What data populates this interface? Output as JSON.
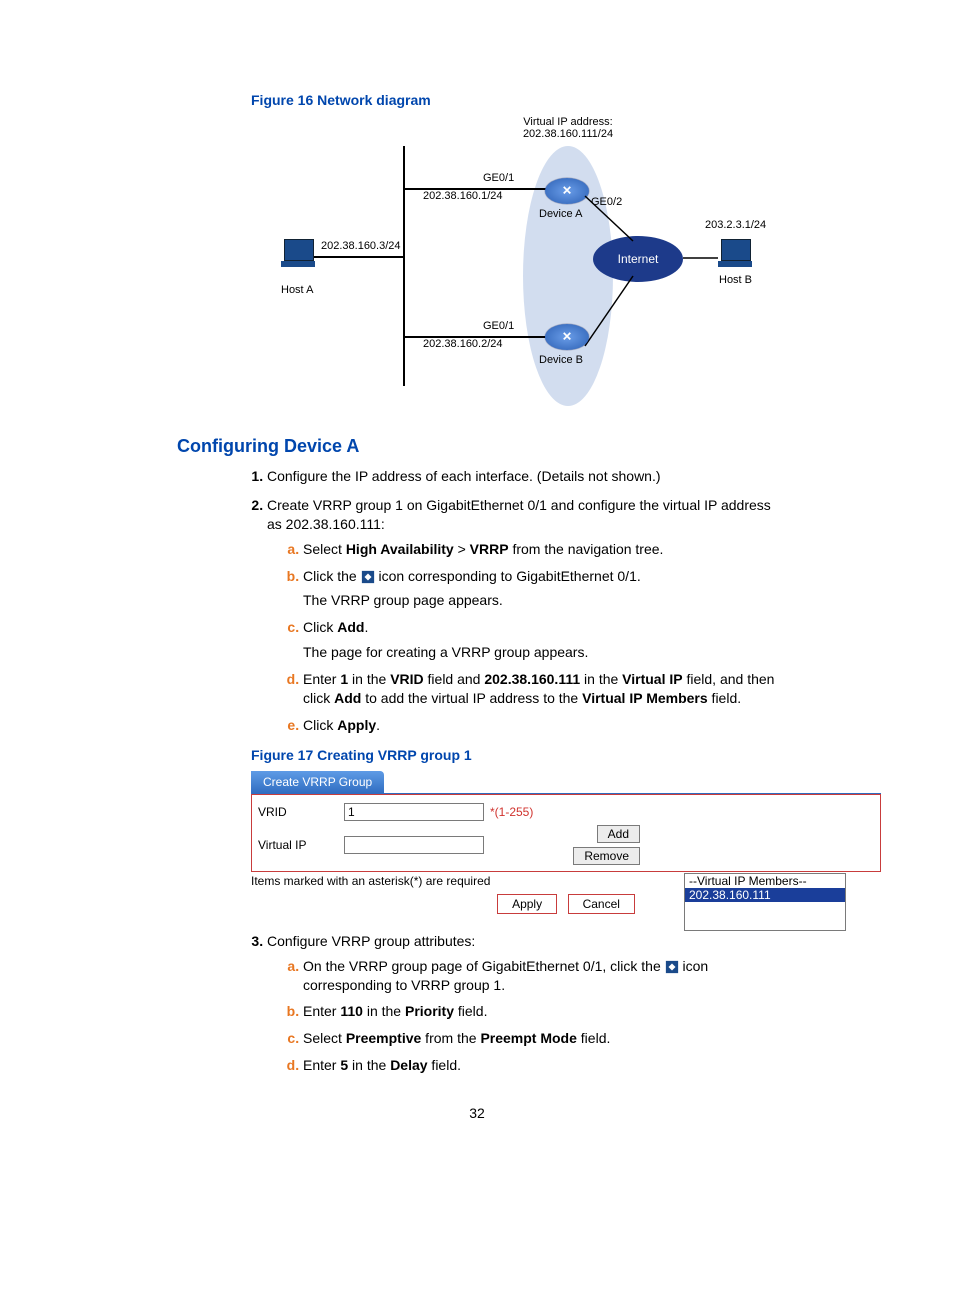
{
  "figure16_caption": "Figure 16 Network diagram",
  "diagram": {
    "virtual_ip_label": "Virtual IP address:",
    "virtual_ip_value": "202.38.160.111/24",
    "ge01_a": "GE0/1",
    "ip_ge01_a": "202.38.160.1/24",
    "ge02": "GE0/2",
    "device_a": "Device A",
    "hostb_ip": "203.2.3.1/24",
    "hosta_ip": "202.38.160.3/24",
    "internet": "Internet",
    "host_a": "Host A",
    "host_b": "Host B",
    "ge01_b": "GE0/1",
    "ip_ge01_b": "202.38.160.2/24",
    "device_b": "Device B"
  },
  "section_title": "Configuring Device A",
  "step1": "Configure the IP address of each interface. (Details not shown.)",
  "step2_pre": "Create VRRP group 1 on GigabitEthernet 0/1 and configure the virtual IP address as 202.38.160.111:",
  "step2a_pre": "Select ",
  "step2a_b1": "High Availability",
  "step2a_mid": " > ",
  "step2a_b2": "VRRP",
  "step2a_post": " from the navigation tree.",
  "step2b_pre": "Click the ",
  "step2b_post": " icon corresponding to GigabitEthernet 0/1.",
  "step2b_follow": "The VRRP group page appears.",
  "step2c_pre": "Click ",
  "step2c_b": "Add",
  "step2c_post": ".",
  "step2c_follow": "The page for creating a VRRP group appears.",
  "step2d_pre": "Enter ",
  "step2d_b1": "1",
  "step2d_mid1": " in the ",
  "step2d_b2": "VRID",
  "step2d_mid2": " field and ",
  "step2d_b3": "202.38.160.111",
  "step2d_mid3": " in the ",
  "step2d_b4": "Virtual IP",
  "step2d_mid4": " field, and then click ",
  "step2d_b5": "Add",
  "step2d_mid5": " to add the virtual IP address to the ",
  "step2d_b6": "Virtual IP Members",
  "step2d_post": " field.",
  "step2e_pre": "Click ",
  "step2e_b": "Apply",
  "step2e_post": ".",
  "figure17_caption": "Figure 17 Creating VRRP group 1",
  "fig17": {
    "tab": "Create VRRP Group",
    "vrid_label": "VRID",
    "vrid_value": "1",
    "vrid_hint": "*(1-255)",
    "vip_label": "Virtual IP",
    "add_btn": "Add",
    "remove_btn": "Remove",
    "members_header": "--Virtual IP Members--",
    "members_item": "202.38.160.111",
    "req_note": "Items marked with an asterisk(*) are required",
    "apply": "Apply",
    "cancel": "Cancel"
  },
  "step3": "Configure VRRP group attributes:",
  "step3a_pre": "On the VRRP group page of GigabitEthernet 0/1, click the ",
  "step3a_post": " icon corresponding to VRRP group 1.",
  "step3b_pre": "Enter ",
  "step3b_b1": "110",
  "step3b_mid": " in the ",
  "step3b_b2": "Priority",
  "step3b_post": " field.",
  "step3c_pre": "Select ",
  "step3c_b1": "Preemptive",
  "step3c_mid": " from the ",
  "step3c_b2": "Preempt Mode",
  "step3c_post": " field.",
  "step3d_pre": "Enter ",
  "step3d_b1": "5",
  "step3d_mid": " in the ",
  "step3d_b2": "Delay",
  "step3d_post": " field.",
  "page_number": "32"
}
